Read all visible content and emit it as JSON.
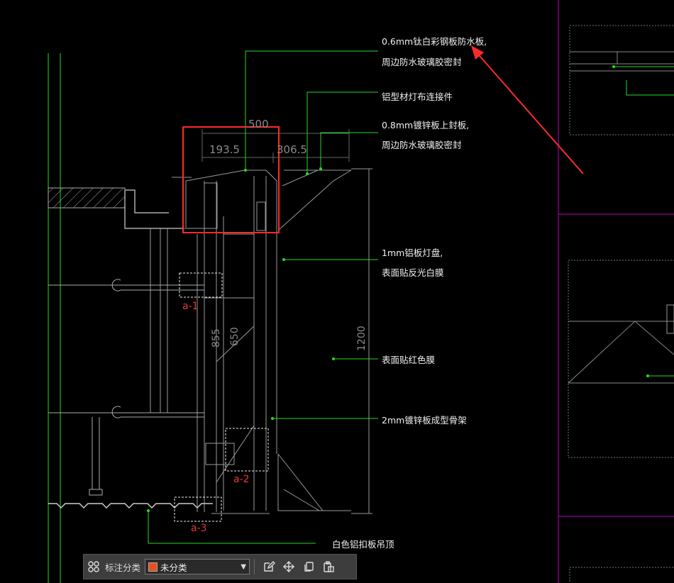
{
  "drawing": {
    "annotations": [
      {
        "id": "a1",
        "text": "0.6mm钛白彩钢板防水板,"
      },
      {
        "id": "a2",
        "text": "周边防水玻璃胶密封"
      },
      {
        "id": "a3",
        "text": "铝型材灯布连接件"
      },
      {
        "id": "a4",
        "text": "0.8mm镀锌板上封板,"
      },
      {
        "id": "a5",
        "text": "周边防水玻璃胶密封"
      },
      {
        "id": "a6",
        "text": "1mm铝板灯盘,"
      },
      {
        "id": "a7",
        "text": "表面贴反光白膜"
      },
      {
        "id": "a8",
        "text": "表面贴红色膜"
      },
      {
        "id": "a9",
        "text": "2mm镀锌板成型骨架"
      },
      {
        "id": "a10",
        "text": "白色铝扣板吊顶"
      }
    ],
    "dimensions": {
      "top_total": "500",
      "top_left": "193.5",
      "top_right": "306.5",
      "v_855": "855",
      "v_650": "650",
      "v_1200": "1200"
    },
    "detail_tags": {
      "t1": "a-1",
      "t2": "a-2",
      "t3": "a-3"
    },
    "colors": {
      "leader": "#22dd22",
      "linework": "#9a9a9a",
      "highlight": "#ff2a2a",
      "frame": "#c000c0",
      "tag": "#e23a3a"
    }
  },
  "toolbar": {
    "grid_icon": "grid-icon",
    "label": "标注分类",
    "category_value": "未分类",
    "category_color": "#e8501c",
    "icons": [
      "edit-icon",
      "move-icon",
      "copy-icon",
      "paste-icon"
    ]
  }
}
